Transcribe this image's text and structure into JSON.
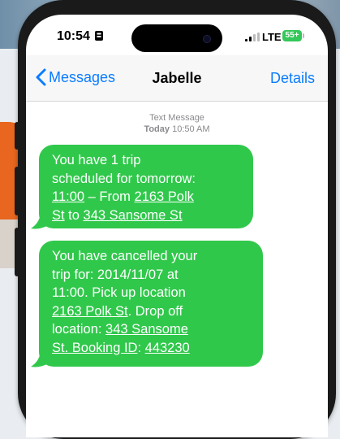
{
  "status_bar": {
    "time": "10:54",
    "network": "LTE",
    "battery": "55+"
  },
  "nav": {
    "back_label": "Messages",
    "contact": "Jabelle",
    "details_label": "Details"
  },
  "thread_meta": {
    "type": "Text Message",
    "timestamp_day": "Today",
    "timestamp_time": "10:50 AM"
  },
  "messages": [
    {
      "line1": "You have 1 trip",
      "line2": "scheduled for tomorrow:",
      "time_link": "11:00",
      "from_text": " – From ",
      "from_link_a": "2163 Polk",
      "from_link_b": "St",
      "to_text": " to ",
      "to_link": "343 Sansome St"
    },
    {
      "line1": " You have cancelled your",
      "line2": "trip for: 2014/11/07 at",
      "line3": "11:00. Pick up location",
      "pickup_link": "2163 Polk St",
      "drop_text": ". Drop off",
      "line5": "location: ",
      "drop_link_a": "343 Sansome",
      "drop_link_b": "St. Booking ID",
      "colon": ": ",
      "booking_id": "443230"
    }
  ],
  "colors": {
    "bubble_green": "#30c84b",
    "link_blue": "#0a7cff",
    "background_orange": "#e8661f"
  }
}
